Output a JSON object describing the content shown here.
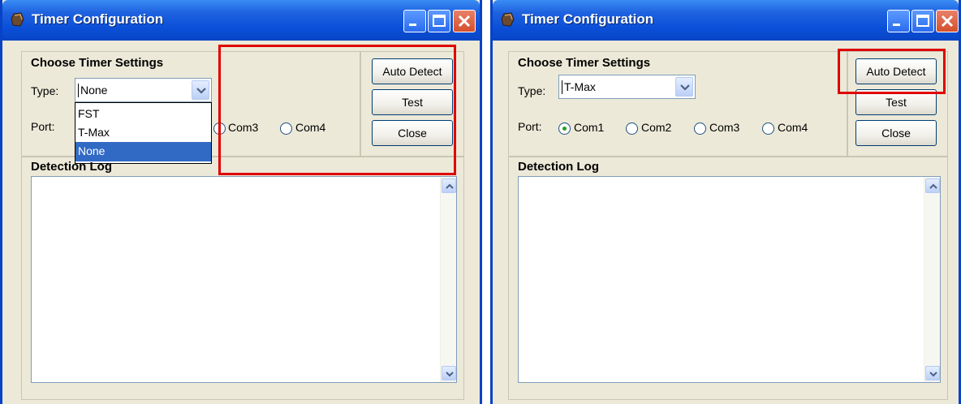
{
  "colors": {
    "highlight": "#E00000",
    "title_bar": "#0A4FD8",
    "window_bg": "#ECE9D8",
    "selection": "#316AC5"
  },
  "left_window": {
    "title": "Timer Configuration",
    "group_title": "Choose Timer Settings",
    "type_label": "Type:",
    "type_value": "None",
    "dropdown_options": [
      "FST",
      "T-Max",
      "None"
    ],
    "dropdown_selected": "None",
    "port_label": "Port:",
    "ports": [
      "Com3",
      "Com4"
    ],
    "buttons": {
      "auto_detect": "Auto Detect",
      "test": "Test",
      "close": "Close"
    },
    "log_title": "Detection Log"
  },
  "right_window": {
    "title": "Timer Configuration",
    "group_title": "Choose Timer Settings",
    "type_label": "Type:",
    "type_value": "T-Max",
    "port_label": "Port:",
    "ports": [
      "Com1",
      "Com2",
      "Com3",
      "Com4"
    ],
    "selected_port": "Com1",
    "buttons": {
      "auto_detect": "Auto Detect",
      "test": "Test",
      "close": "Close"
    },
    "log_title": "Detection Log"
  },
  "icons": [
    "timer-app-icon",
    "minimize-icon",
    "maximize-icon",
    "close-icon",
    "chevron-down-icon",
    "scroll-up-icon",
    "scroll-down-icon"
  ]
}
